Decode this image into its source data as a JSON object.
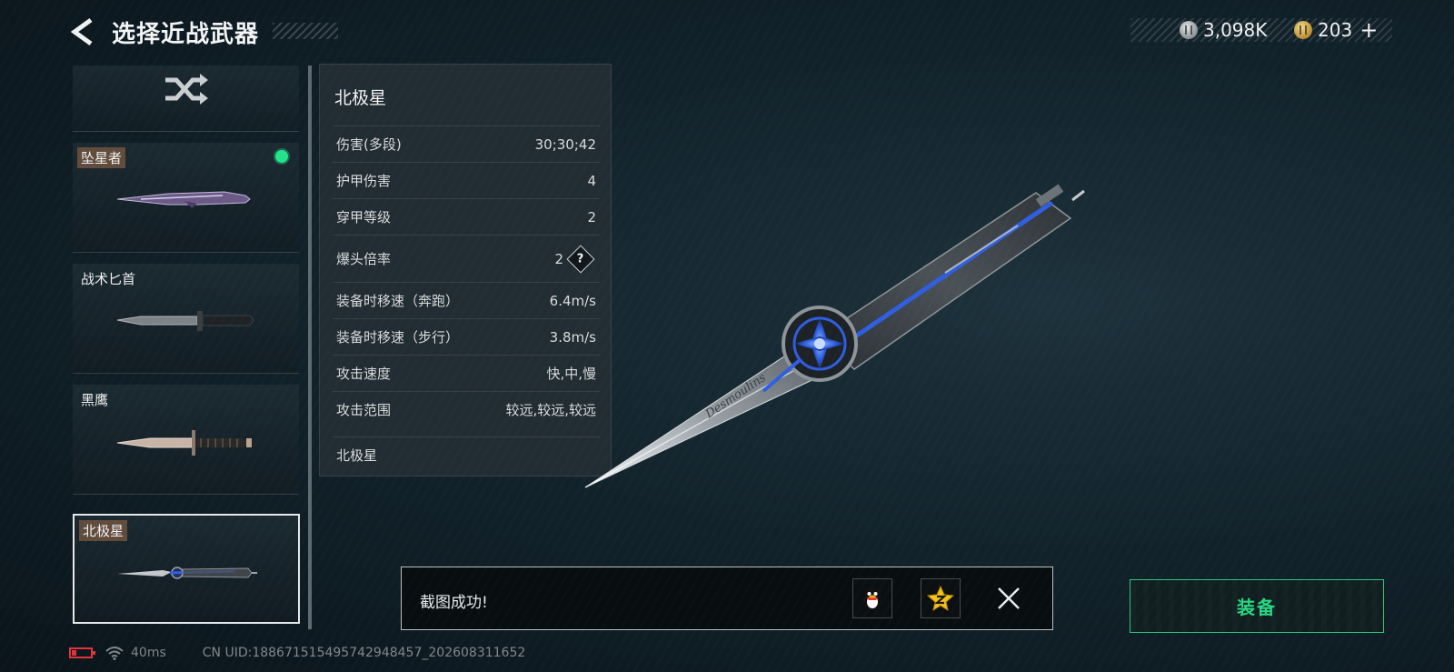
{
  "header": {
    "title": "选择近战武器"
  },
  "currency": {
    "coin_amount": "3,098K",
    "coin_icon": "silver-coin-icon",
    "premium_amount": "203",
    "premium_icon": "gold-coin-icon",
    "plus_label": "+"
  },
  "weapon_list": [
    {
      "name": "坠星者",
      "equipped": true,
      "selected": false
    },
    {
      "name": "战术匕首",
      "equipped": false,
      "selected": false
    },
    {
      "name": "黑鹰",
      "equipped": false,
      "selected": false
    },
    {
      "name": "北极星",
      "equipped": false,
      "selected": true
    }
  ],
  "stats": {
    "title": "北极星",
    "rows": [
      {
        "label": "伤害(多段)",
        "value": "30;30;42"
      },
      {
        "label": "护甲伤害",
        "value": "4"
      },
      {
        "label": "穿甲等级",
        "value": "2"
      },
      {
        "label": "爆头倍率",
        "value": "2"
      },
      {
        "label": "装备时移速（奔跑）",
        "value": "6.4m/s"
      },
      {
        "label": "装备时移速（步行）",
        "value": "3.8m/s"
      },
      {
        "label": "攻击速度",
        "value": "快,中,慢"
      },
      {
        "label": "攻击范围",
        "value": "较远,较远,较远"
      }
    ],
    "help_symbol": "?",
    "footer": "北极星"
  },
  "hero_weapon": {
    "engraving": "Desmoulins"
  },
  "toast": {
    "message": "截图成功!"
  },
  "equip_button": {
    "label": "装备"
  },
  "status_bar": {
    "ping": "40ms",
    "uid": "CN UID:18867151549574294845​7_202608311652"
  },
  "colors": {
    "accent_green": "#28d784",
    "equipped_dot": "#22e28a",
    "battery_low": "#e0343a",
    "sapphire_blue": "#2f5fe0"
  }
}
